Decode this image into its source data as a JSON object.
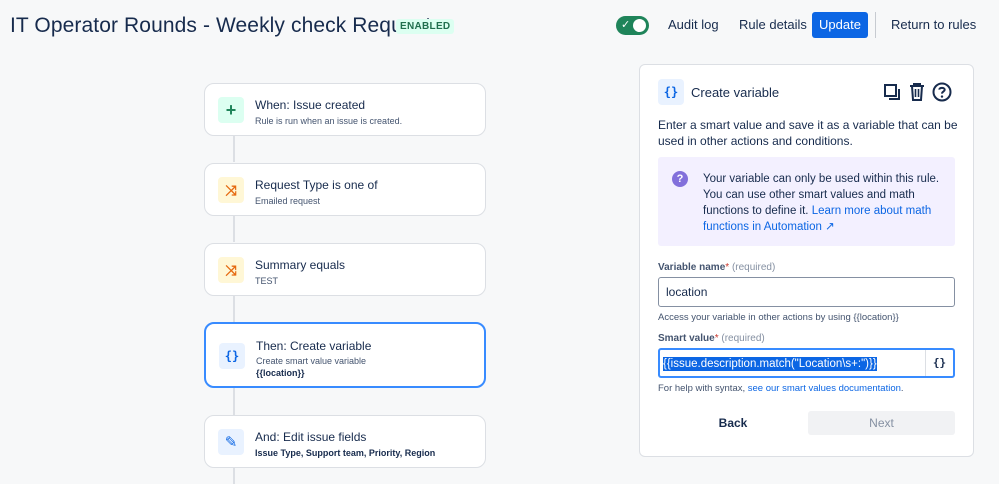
{
  "header": {
    "title": "IT Operator Rounds - Weekly check Requests",
    "status_badge": "ENABLED",
    "toggle_check": "✓",
    "audit_log": "Audit log",
    "rule_details": "Rule details",
    "update": "Update",
    "return_to_rules": "Return to rules"
  },
  "flow": {
    "trigger": {
      "icon": "+",
      "title": "When: Issue created",
      "subtitle": "Rule is run when an issue is created."
    },
    "condition1": {
      "icon": "⤨",
      "title": "Request Type is one of",
      "subtitle": "Emailed request"
    },
    "condition2": {
      "icon": "⤨",
      "title": "Summary equals",
      "subtitle": "TEST"
    },
    "action1": {
      "icon": "{}",
      "title": "Then: Create variable",
      "subtitle": "Create smart value variable",
      "subtitle2": "{{location}}"
    },
    "action2": {
      "icon": "✎",
      "title": "And: Edit issue fields",
      "subtitle": "Issue Type, Support team, Priority, Region"
    }
  },
  "panel": {
    "icon": "{}",
    "title": "Create variable",
    "description": "Enter a smart value and save it as a variable that can be used in other actions and conditions.",
    "info_text": "Your variable can only be used within this rule. You can use other smart values and math functions to define it. ",
    "info_link": "Learn more about math functions in Automation ↗",
    "variable_name_label": "Variable name",
    "required_star": "*",
    "required_text": "(required)",
    "variable_name_value": "location",
    "variable_help": "Access your variable in other actions by using {{location}}",
    "smart_value_label": "Smart value",
    "smart_value": "{{issue.description.match(\"Location\\s+:\")}}",
    "smart_brace": "{}",
    "syntax_help": "For help with syntax, ",
    "syntax_link": "see our smart values documentation",
    "syntax_end": ".",
    "back": "Back",
    "next": "Next"
  },
  "colors": {
    "accent": "#0c66e4",
    "toggle": "#1f845a",
    "selected_border": "#388bff"
  }
}
